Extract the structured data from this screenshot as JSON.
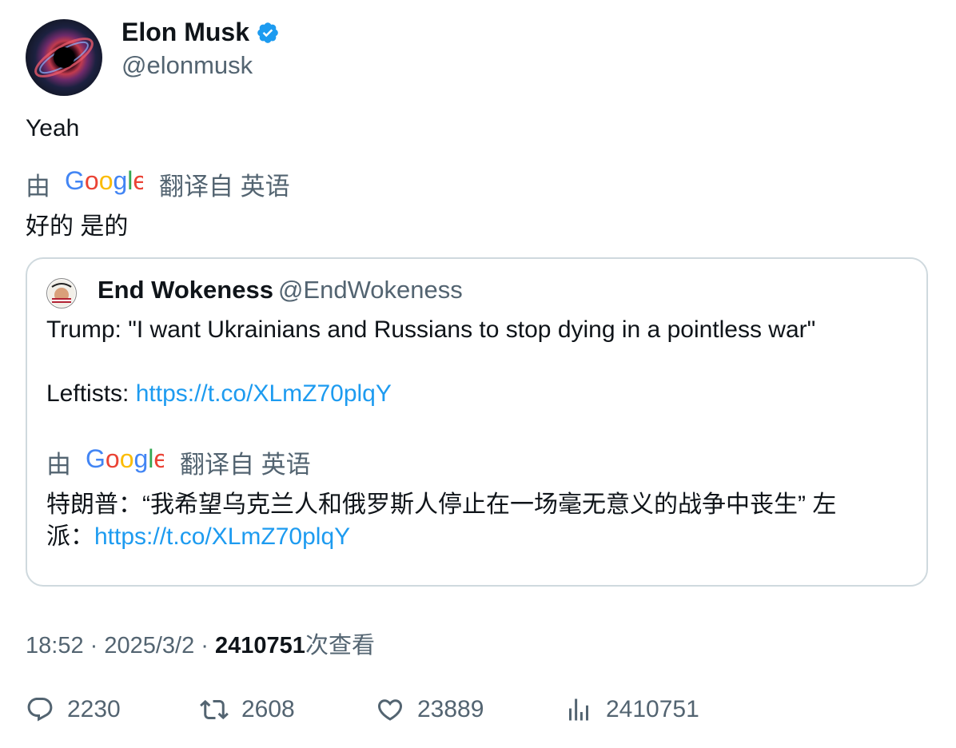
{
  "author": {
    "name": "Elon Musk",
    "handle": "@elonmusk"
  },
  "tweet": {
    "text": "Yeah",
    "translation_by": "由",
    "translation_brand": "Google",
    "translation_source": "翻译自 英语",
    "translated_text": "好的 是的"
  },
  "quote": {
    "name": "End Wokeness",
    "handle": "@EndWokeness",
    "line1": "Trump: \"I want Ukrainians and Russians to stop dying in a pointless war\"",
    "line2_prefix": "Leftists: ",
    "link": "https://t.co/XLmZ70plqY",
    "translation_by": "由",
    "translation_brand": "Google",
    "translation_source": "翻译自 英语",
    "translated_line1": "特朗普：“我希望乌克兰人和俄罗斯人停止在一场毫无意义的战争中丧生” 左",
    "translated_line2_prefix": "派：",
    "translated_link": "https://t.co/XLmZ70plqY"
  },
  "meta": {
    "time": "18:52",
    "separator": " · ",
    "date": "2025/3/2",
    "views": "2410751",
    "views_suffix": "次查看"
  },
  "actions": {
    "replies": "2230",
    "retweets": "2608",
    "likes": "23889",
    "views": "2410751"
  },
  "colors": {
    "text": "#0f1419",
    "muted": "#536471",
    "link": "#1d9bf0",
    "verified": "#1d9bf0",
    "border": "#cfd9de"
  },
  "icons": [
    "verified-badge-icon",
    "reply-icon",
    "retweet-icon",
    "like-icon",
    "views-icon"
  ]
}
